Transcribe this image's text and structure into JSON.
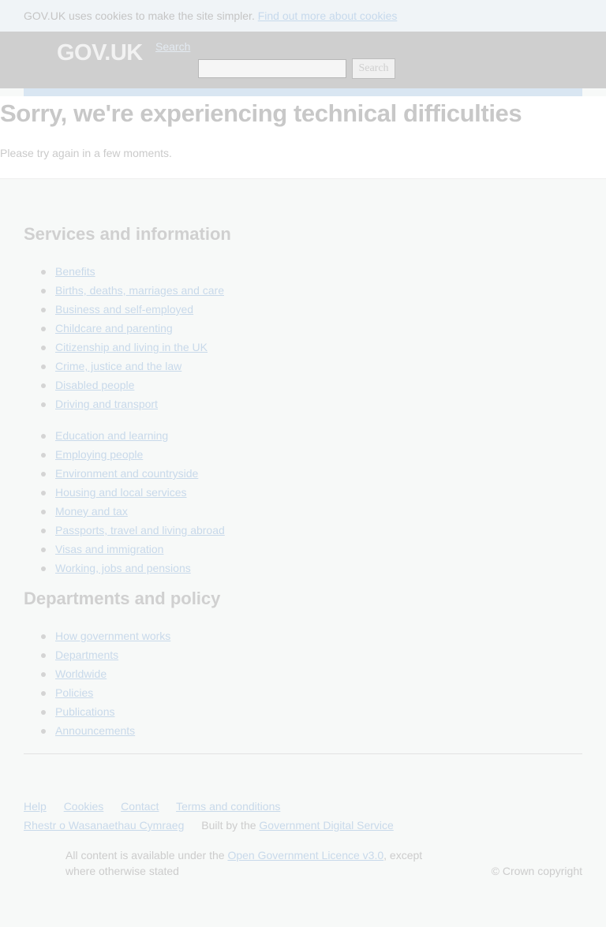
{
  "cookie_banner": {
    "text": "GOV.UK uses cookies to make the site simpler.",
    "link": "Find out more about cookies"
  },
  "header": {
    "logo": "GOV.UK",
    "search_link": "Search",
    "search_button": "Search"
  },
  "main": {
    "title": "Sorry, we're experiencing technical difficulties",
    "message": "Please try again in a few moments."
  },
  "services": {
    "heading": "Services and information",
    "group1": [
      "Benefits",
      "Births, deaths, marriages and care",
      "Business and self-employed",
      "Childcare and parenting",
      "Citizenship and living in the UK",
      "Crime, justice and the law",
      "Disabled people",
      "Driving and transport"
    ],
    "group2": [
      "Education and learning",
      "Employing people",
      "Environment and countryside",
      "Housing and local services",
      "Money and tax",
      "Passports, travel and living abroad",
      "Visas and immigration",
      "Working, jobs and pensions"
    ]
  },
  "departments": {
    "heading": "Departments and policy",
    "items": [
      "How government works",
      "Departments",
      "Worldwide",
      "Policies",
      "Publications",
      "Announcements"
    ]
  },
  "footer": {
    "links": [
      "Help",
      "Cookies",
      "Contact",
      "Terms and conditions"
    ],
    "welsh": "Rhestr o Wasanaethau Cymraeg",
    "built_by": "Built by the",
    "built_by_link": "Government Digital Service",
    "licence_pre": "All content is available under the",
    "licence_link": "Open Government Licence v3.0",
    "licence_post": ", except where otherwise stated",
    "copyright": "© Crown copyright"
  }
}
